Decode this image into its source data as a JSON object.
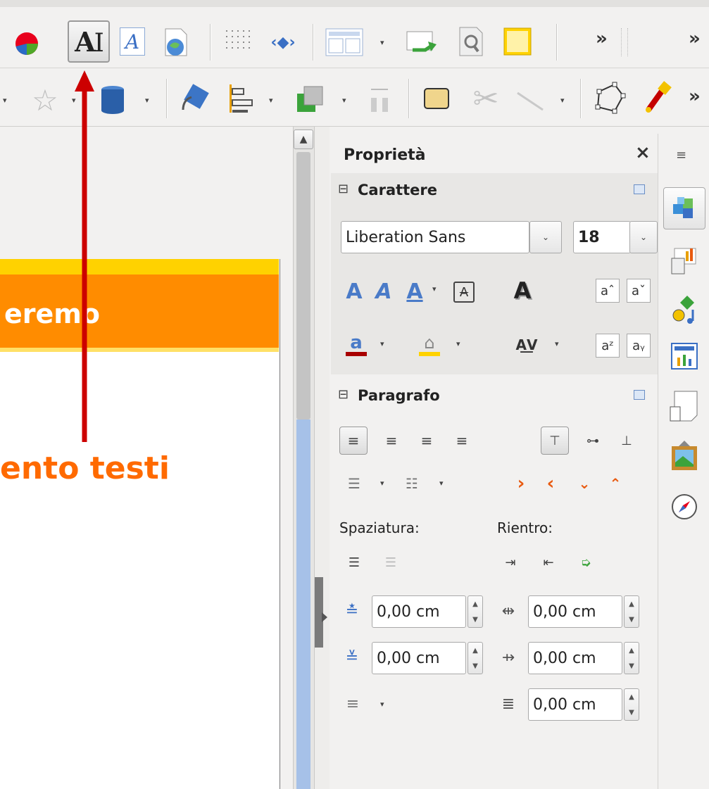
{
  "toolbar1": {
    "overflow1": "»",
    "overflow2": "»"
  },
  "toolbar2": {
    "overflow": "»"
  },
  "slide": {
    "title_fragment": "eremo",
    "annotation_text": "ento testi"
  },
  "sidebar": {
    "title": "Proprietà",
    "close": "×",
    "menu": "≡",
    "carattere": {
      "header": "Carattere",
      "toggle": "⊟",
      "font_name": "Liberation Sans",
      "font_size": "18"
    },
    "paragrafo": {
      "header": "Paragrafo",
      "toggle": "⊟",
      "spaziatura_label": "Spaziatura:",
      "rientro_label": "Rientro:",
      "above_spacing": "0,00 cm",
      "below_spacing": "0,00 cm",
      "before_indent": "0,00 cm",
      "after_indent": "0,00 cm",
      "first_line_indent": "0,00 cm"
    }
  },
  "colors": {
    "slide_header_orange": "#ff8c00",
    "slide_header_yellow": "#ffd200",
    "annotation_orange": "#ff6a00",
    "arrow_red": "#cc0000",
    "scroll_blue": "#a6c1e8"
  }
}
